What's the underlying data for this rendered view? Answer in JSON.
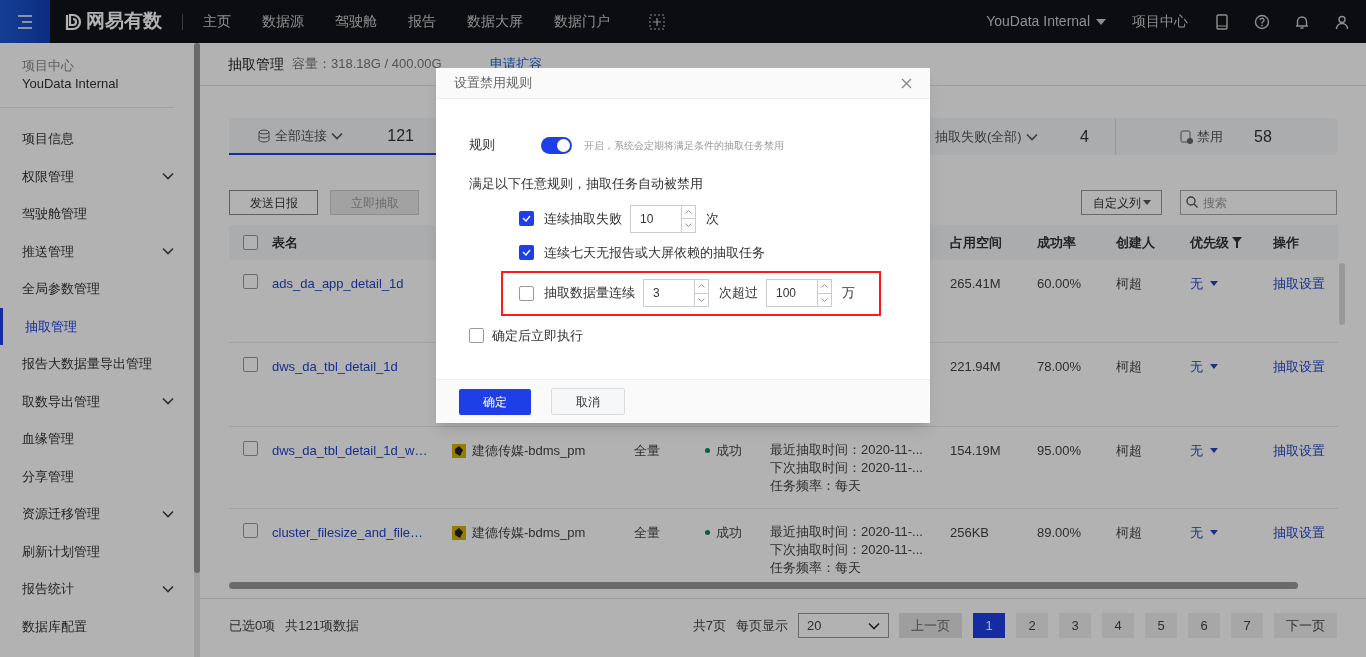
{
  "topbar": {
    "brand": "网易有数",
    "nav": [
      {
        "label": "主页"
      },
      {
        "label": "数据源"
      },
      {
        "label": "驾驶舱"
      },
      {
        "label": "报告"
      },
      {
        "label": "数据大屏"
      },
      {
        "label": "数据门户"
      }
    ],
    "project": "YouData Internal",
    "project_center": "项目中心"
  },
  "sidebar": {
    "caption": "项目中心",
    "project": "YouData Internal",
    "items": [
      {
        "label": "项目信息",
        "expandable": false,
        "selected": false
      },
      {
        "label": "权限管理",
        "expandable": true,
        "selected": false
      },
      {
        "label": "驾驶舱管理",
        "expandable": false,
        "selected": false
      },
      {
        "label": "推送管理",
        "expandable": true,
        "selected": false
      },
      {
        "label": "全局参数管理",
        "expandable": false,
        "selected": false
      },
      {
        "label": "抽取管理",
        "expandable": false,
        "selected": true
      },
      {
        "label": "报告大数据量导出管理",
        "expandable": false,
        "selected": false
      },
      {
        "label": "取数导出管理",
        "expandable": true,
        "selected": false
      },
      {
        "label": "血缘管理",
        "expandable": false,
        "selected": false
      },
      {
        "label": "分享管理",
        "expandable": false,
        "selected": false
      },
      {
        "label": "资源迁移管理",
        "expandable": true,
        "selected": false
      },
      {
        "label": "刷新计划管理",
        "expandable": false,
        "selected": false
      },
      {
        "label": "报告统计",
        "expandable": true,
        "selected": false
      },
      {
        "label": "数据库配置",
        "expandable": false,
        "selected": false
      }
    ]
  },
  "page": {
    "title": "抽取管理",
    "capacity": "容量：318.18G / 400.00G",
    "expand_link": "申请扩容"
  },
  "stats": [
    {
      "kind": "all",
      "label": "全部连接",
      "count": "121",
      "selected": true
    },
    {
      "kind": "failed",
      "label": "抽取失败(全部)",
      "count": "4",
      "selected": false
    },
    {
      "kind": "disabled",
      "label": "禁用",
      "count": "58",
      "selected": false
    }
  ],
  "toolbar": {
    "buttons": [
      {
        "label": "发送日报",
        "disabled": false
      },
      {
        "label": "立即抽取",
        "disabled": true
      }
    ],
    "columns_button": "自定义列",
    "search": {
      "placeholder": "搜索"
    }
  },
  "table": {
    "select_all_checked": false,
    "columns": [
      {
        "label": "表名"
      },
      {
        "label": "占用空间"
      },
      {
        "label": "成功率"
      },
      {
        "label": "创建人"
      },
      {
        "label": "优先级"
      },
      {
        "label": "操作"
      }
    ],
    "rows": [
      {
        "checked": false,
        "name": "ads_da_app_detail_1d",
        "space": "265.41M",
        "rate": "60.00%",
        "creator": "柯超",
        "priority": "无",
        "action": "抽取设置"
      },
      {
        "checked": false,
        "name": "dws_da_tbl_detail_1d",
        "space": "221.94M",
        "rate": "78.00%",
        "creator": "柯超",
        "priority": "无",
        "action": "抽取设置"
      },
      {
        "checked": false,
        "name": "dws_da_tbl_detail_1d_w…",
        "source": "建德传媒-bdms_pm",
        "type": "全量",
        "status": "成功",
        "schedule": [
          "最近抽取时间：2020-11-...",
          "下次抽取时间：2020-11-...",
          "任务频率：每天"
        ],
        "space": "154.19M",
        "rate": "95.00%",
        "creator": "柯超",
        "priority": "无",
        "action": "抽取设置"
      },
      {
        "checked": false,
        "name": "cluster_filesize_and_file…",
        "source": "建德传媒-bdms_pm",
        "type": "全量",
        "status": "成功",
        "schedule": [
          "最近抽取时间：2020-11-...",
          "下次抽取时间：2020-11-...",
          "任务频率：每天"
        ],
        "space": "256KB",
        "rate": "89.00%",
        "creator": "柯超",
        "priority": "无",
        "action": "抽取设置"
      }
    ]
  },
  "footer": {
    "selected": "已选0项",
    "total": "共121项数据",
    "pages": "共7页",
    "per_page_label": "每页显示",
    "per_page": "20",
    "prev": "上一页",
    "next": "下一页",
    "page_numbers": [
      {
        "label": "1",
        "selected": true
      },
      {
        "label": "2",
        "selected": false
      },
      {
        "label": "3",
        "selected": false
      },
      {
        "label": "4",
        "selected": false
      },
      {
        "label": "5",
        "selected": false
      },
      {
        "label": "6",
        "selected": false
      },
      {
        "label": "7",
        "selected": false
      }
    ]
  },
  "dialog": {
    "title": "设置禁用规则",
    "rule_label": "规则",
    "enabled": true,
    "hint": "开启，系统会定期将满足条件的抽取任务禁用",
    "intro": "满足以下任意规则，抽取任务自动被禁用",
    "rules": [
      {
        "checked": true,
        "highlighted": false,
        "parts": [
          {
            "kind": "text",
            "text": "连续抽取失败"
          },
          {
            "kind": "number",
            "value": "10"
          },
          {
            "kind": "text",
            "text": "次"
          }
        ]
      },
      {
        "checked": true,
        "highlighted": false,
        "parts": [
          {
            "kind": "text",
            "text": "连续七天无报告或大屏依赖的抽取任务"
          }
        ]
      },
      {
        "checked": false,
        "highlighted": true,
        "parts": [
          {
            "kind": "text",
            "text": "抽取数据量连续"
          },
          {
            "kind": "number",
            "value": "3"
          },
          {
            "kind": "text",
            "text": "次超过"
          },
          {
            "kind": "number",
            "value": "100"
          },
          {
            "kind": "text",
            "text": "万"
          }
        ]
      }
    ],
    "run_now": {
      "label": "确定后立即执行",
      "checked": false
    },
    "ok": "确定",
    "cancel": "取消"
  }
}
